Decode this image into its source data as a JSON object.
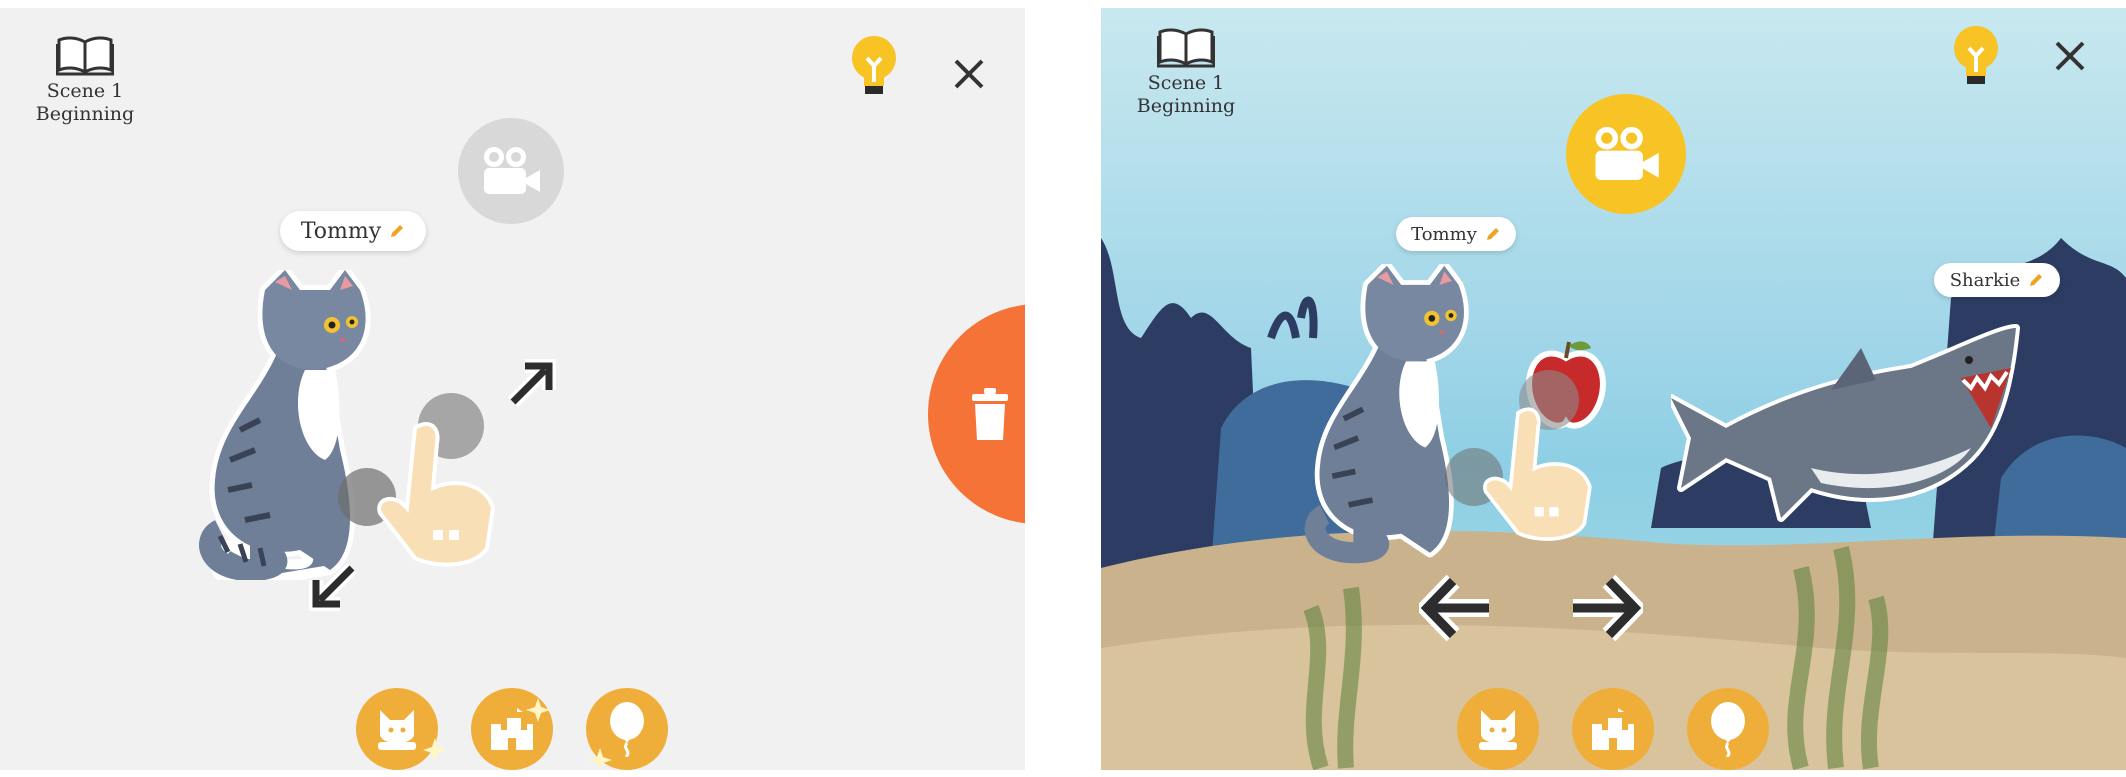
{
  "left": {
    "scene_label_line1": "Scene 1",
    "scene_label_line2": "Beginning",
    "character_name": "Tommy"
  },
  "right": {
    "scene_label_line1": "Scene 1",
    "scene_label_line2": "Beginning",
    "character_name": "Tommy",
    "shark_name": "Sharkie"
  },
  "icons": {
    "book": "book-icon",
    "hint": "lightbulb-icon",
    "close": "close-icon",
    "camera": "video-camera-icon",
    "delete": "trash-icon",
    "edit": "pencil-icon",
    "palette": [
      "character-icon",
      "castle-icon",
      "balloon-icon"
    ]
  },
  "colors": {
    "left_background": "#f1f1f1",
    "accent_yellow": "#f7c325",
    "palette_orange": "#efae3a",
    "delete_orange": "#f57336",
    "camera_disabled": "#d7d7d7"
  }
}
